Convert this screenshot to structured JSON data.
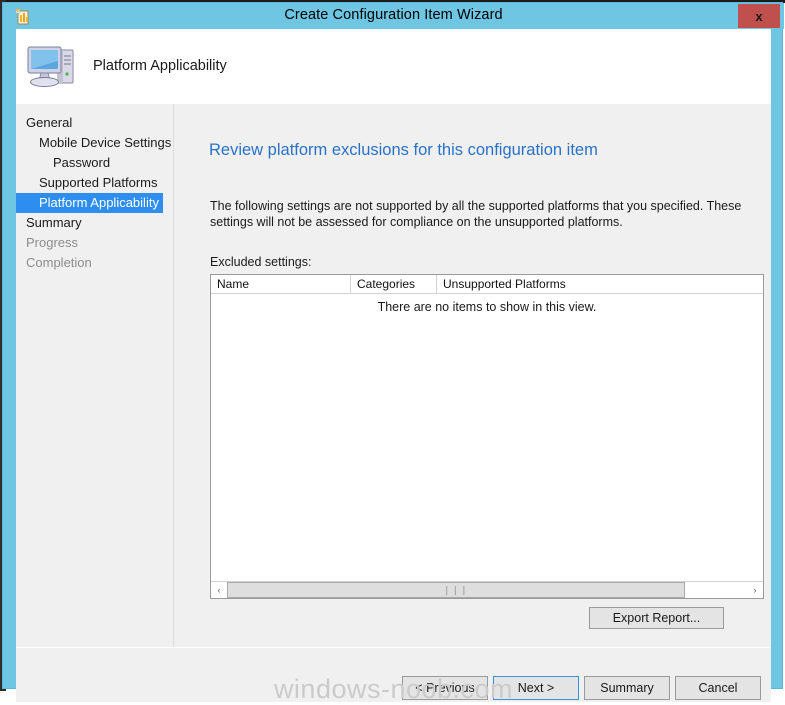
{
  "window": {
    "title": "Create Configuration Item Wizard",
    "close_label": "x",
    "icon": "wizard-config-item-icon"
  },
  "header": {
    "title": "Platform Applicability",
    "icon": "computer-monitor-icon"
  },
  "sidebar": {
    "items": [
      {
        "label": "General",
        "level": 1,
        "state": "normal"
      },
      {
        "label": "Mobile Device Settings",
        "level": 2,
        "state": "normal"
      },
      {
        "label": "Password",
        "level": 3,
        "state": "normal"
      },
      {
        "label": "Supported Platforms",
        "level": 2,
        "state": "normal"
      },
      {
        "label": "Platform Applicability",
        "level": 2,
        "state": "selected"
      },
      {
        "label": "Summary",
        "level": 1,
        "state": "normal"
      },
      {
        "label": "Progress",
        "level": 1,
        "state": "disabled"
      },
      {
        "label": "Completion",
        "level": 1,
        "state": "disabled"
      }
    ],
    "scrollbar": {
      "left_arrow": "‹",
      "right_arrow": "›",
      "grip": "❘❘❘"
    }
  },
  "main": {
    "heading": "Review platform exclusions for this configuration item",
    "description": "The following settings are not supported by all the supported platforms that you specified. These settings will not be assessed for compliance on the unsupported platforms.",
    "excluded_label": "Excluded settings:",
    "table": {
      "columns": [
        "Name",
        "Categories",
        "Unsupported Platforms"
      ],
      "rows": [],
      "empty_message": "There are no items to show in this view."
    },
    "scrollbar": {
      "left_arrow": "‹",
      "right_arrow": "›",
      "grip": "❘❘❘"
    },
    "export_report_label": "Export Report..."
  },
  "footer": {
    "previous_label": "< Previous",
    "next_label": "Next >",
    "summary_label": "Summary",
    "cancel_label": "Cancel"
  },
  "watermark": "windows-noob.com",
  "colors": {
    "frame": "#6ec6e3",
    "selection": "#2e8ef0",
    "heading": "#2a72c8",
    "close": "#c0504d",
    "focus_border": "#3c8fd8"
  }
}
